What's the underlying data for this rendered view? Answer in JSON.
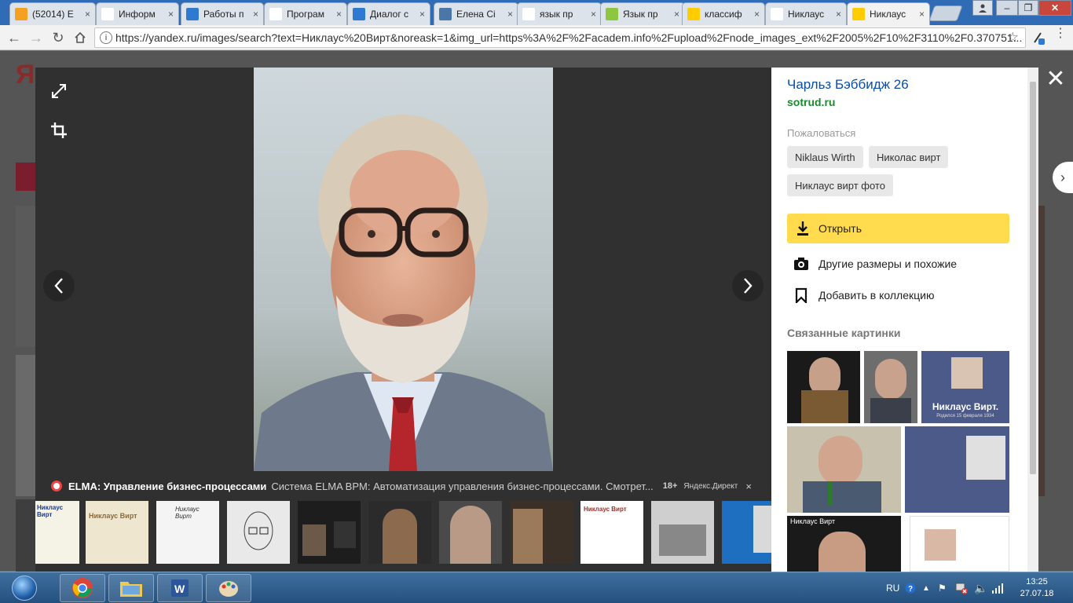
{
  "browser": {
    "tabs": [
      {
        "title": "(52014) E",
        "icon": "opera-icon",
        "color": "#f4a020"
      },
      {
        "title": "Информ",
        "icon": "vs-icon",
        "color": "#ffffff"
      },
      {
        "title": "Работы п",
        "icon": "feather-icon",
        "color": "#2f7ad1"
      },
      {
        "title": "Програм",
        "icon": "vs-icon",
        "color": "#ffffff"
      },
      {
        "title": "Диалог с",
        "icon": "feather-icon",
        "color": "#2f7ad1"
      },
      {
        "title": "Елена Сі",
        "icon": "vk-icon",
        "color": "#4a76a8"
      },
      {
        "title": "язык пр",
        "icon": "yandex-icon",
        "color": "#ffffff"
      },
      {
        "title": "Язык пр",
        "icon": "info-icon",
        "color": "#8dc63f"
      },
      {
        "title": "классиф",
        "icon": "yandex-images-icon",
        "color": "#ffcc00"
      },
      {
        "title": "Никлаус",
        "icon": "yandex-icon",
        "color": "#ffffff"
      },
      {
        "title": "Никлаус",
        "icon": "yandex-images-icon",
        "color": "#ffcc00"
      }
    ],
    "tab_close": "×",
    "url": "https://yandex.ru/images/search?text=Никлаус%20Вирт&noreask=1&img_url=https%3A%2F%2Facadem.info%2Fupload%2Fnode_images_ext%2F2005%2F10%2F3110%2F0.370751..."
  },
  "page_bg": {
    "logo": "Ян"
  },
  "viewer": {
    "ad": {
      "title": "ELMA: Управление бизнес-процессами",
      "text": "Система ELMA BPM: Автоматизация управления бизнес-процессами. Смотрет...",
      "age": "18+",
      "source": "Яндекс.Директ",
      "close": "×"
    },
    "thumbs": [
      {
        "caption": "Никлаус Вирт"
      },
      {
        "caption": "Никлаус Вирт"
      },
      {
        "caption": "Никлаус Вирт"
      },
      {
        "caption": ""
      },
      {
        "caption": ""
      },
      {
        "caption": ""
      },
      {
        "caption": ""
      },
      {
        "caption": ""
      },
      {
        "caption": "Никлаус Вирт"
      },
      {
        "caption": ""
      },
      {
        "caption": ""
      },
      {
        "caption": ""
      }
    ]
  },
  "side": {
    "title": "Чарльз Бэббидж 26",
    "domain": "sotrud.ru",
    "complain": "Пожаловаться",
    "chips": [
      "Niklaus Wirth",
      "Николас вирт",
      "Никлаус вирт фото"
    ],
    "open_label": "Открыть",
    "other_sizes_label": "Другие размеры и похожие",
    "collection_label": "Добавить в коллекцию",
    "related_heading": "Связанные картинки",
    "related": {
      "card_name": "Никлаус Вирт.",
      "card_sub": "Родился 15 февраля 1934",
      "strip_label": "Никлаус Вирт"
    }
  },
  "taskbar": {
    "lang": "RU",
    "time": "13:25",
    "date": "27.07.18"
  },
  "colors": {
    "accent_yellow": "#ffdb4d",
    "link_blue": "#0a4da3",
    "domain_green": "#1a8a2e"
  }
}
